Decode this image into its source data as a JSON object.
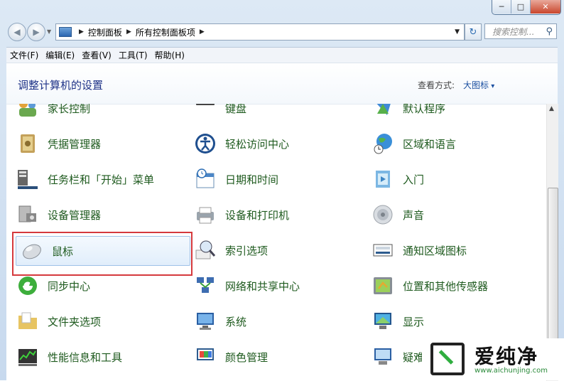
{
  "window": {
    "minimize_glyph": "─",
    "maximize_glyph": "□",
    "close_glyph": "✕"
  },
  "address": {
    "path": [
      "控制面板",
      "所有控制面板项"
    ],
    "search_placeholder": "搜索控制..."
  },
  "menu": [
    "文件(F)",
    "编辑(E)",
    "查看(V)",
    "工具(T)",
    "帮助(H)"
  ],
  "header": {
    "title": "调整计算机的设置",
    "view_label": "查看方式:",
    "view_value": "大图标"
  },
  "items": [
    {
      "label": "家长控制",
      "icon": "parental-controls-icon",
      "col": 0,
      "row": 0
    },
    {
      "label": "键盘",
      "icon": "keyboard-icon",
      "col": 1,
      "row": 0
    },
    {
      "label": "默认程序",
      "icon": "default-programs-icon",
      "col": 2,
      "row": 0
    },
    {
      "label": "凭据管理器",
      "icon": "credential-manager-icon",
      "col": 0,
      "row": 1
    },
    {
      "label": "轻松访问中心",
      "icon": "ease-of-access-icon",
      "col": 1,
      "row": 1
    },
    {
      "label": "区域和语言",
      "icon": "region-language-icon",
      "col": 2,
      "row": 1
    },
    {
      "label": "任务栏和「开始」菜单",
      "icon": "taskbar-start-menu-icon",
      "col": 0,
      "row": 2
    },
    {
      "label": "日期和时间",
      "icon": "date-time-icon",
      "col": 1,
      "row": 2
    },
    {
      "label": "入门",
      "icon": "getting-started-icon",
      "col": 2,
      "row": 2
    },
    {
      "label": "设备管理器",
      "icon": "device-manager-icon",
      "col": 0,
      "row": 3
    },
    {
      "label": "设备和打印机",
      "icon": "devices-printers-icon",
      "col": 1,
      "row": 3
    },
    {
      "label": "声音",
      "icon": "sound-icon",
      "col": 2,
      "row": 3
    },
    {
      "label": "鼠标",
      "icon": "mouse-icon",
      "col": 0,
      "row": 4,
      "selected": true
    },
    {
      "label": "索引选项",
      "icon": "indexing-options-icon",
      "col": 1,
      "row": 4
    },
    {
      "label": "通知区域图标",
      "icon": "notification-area-icon",
      "col": 2,
      "row": 4
    },
    {
      "label": "同步中心",
      "icon": "sync-center-icon",
      "col": 0,
      "row": 5
    },
    {
      "label": "网络和共享中心",
      "icon": "network-sharing-icon",
      "col": 1,
      "row": 5
    },
    {
      "label": "位置和其他传感器",
      "icon": "location-sensors-icon",
      "col": 2,
      "row": 5
    },
    {
      "label": "文件夹选项",
      "icon": "folder-options-icon",
      "col": 0,
      "row": 6
    },
    {
      "label": "系统",
      "icon": "system-icon",
      "col": 1,
      "row": 6
    },
    {
      "label": "显示",
      "icon": "display-icon",
      "col": 2,
      "row": 6
    },
    {
      "label": "性能信息和工具",
      "icon": "performance-tools-icon",
      "col": 0,
      "row": 7
    },
    {
      "label": "颜色管理",
      "icon": "color-management-icon",
      "col": 1,
      "row": 7
    },
    {
      "label": "疑难解答",
      "icon": "troubleshooting-icon",
      "col": 2,
      "row": 7
    }
  ],
  "colors": {
    "link_green": "#1e5a1e",
    "title_blue": "#1e3287",
    "highlight_red": "#d5393d"
  },
  "watermark": {
    "brand": "爱纯净",
    "url": "www.aichunjing.com"
  }
}
